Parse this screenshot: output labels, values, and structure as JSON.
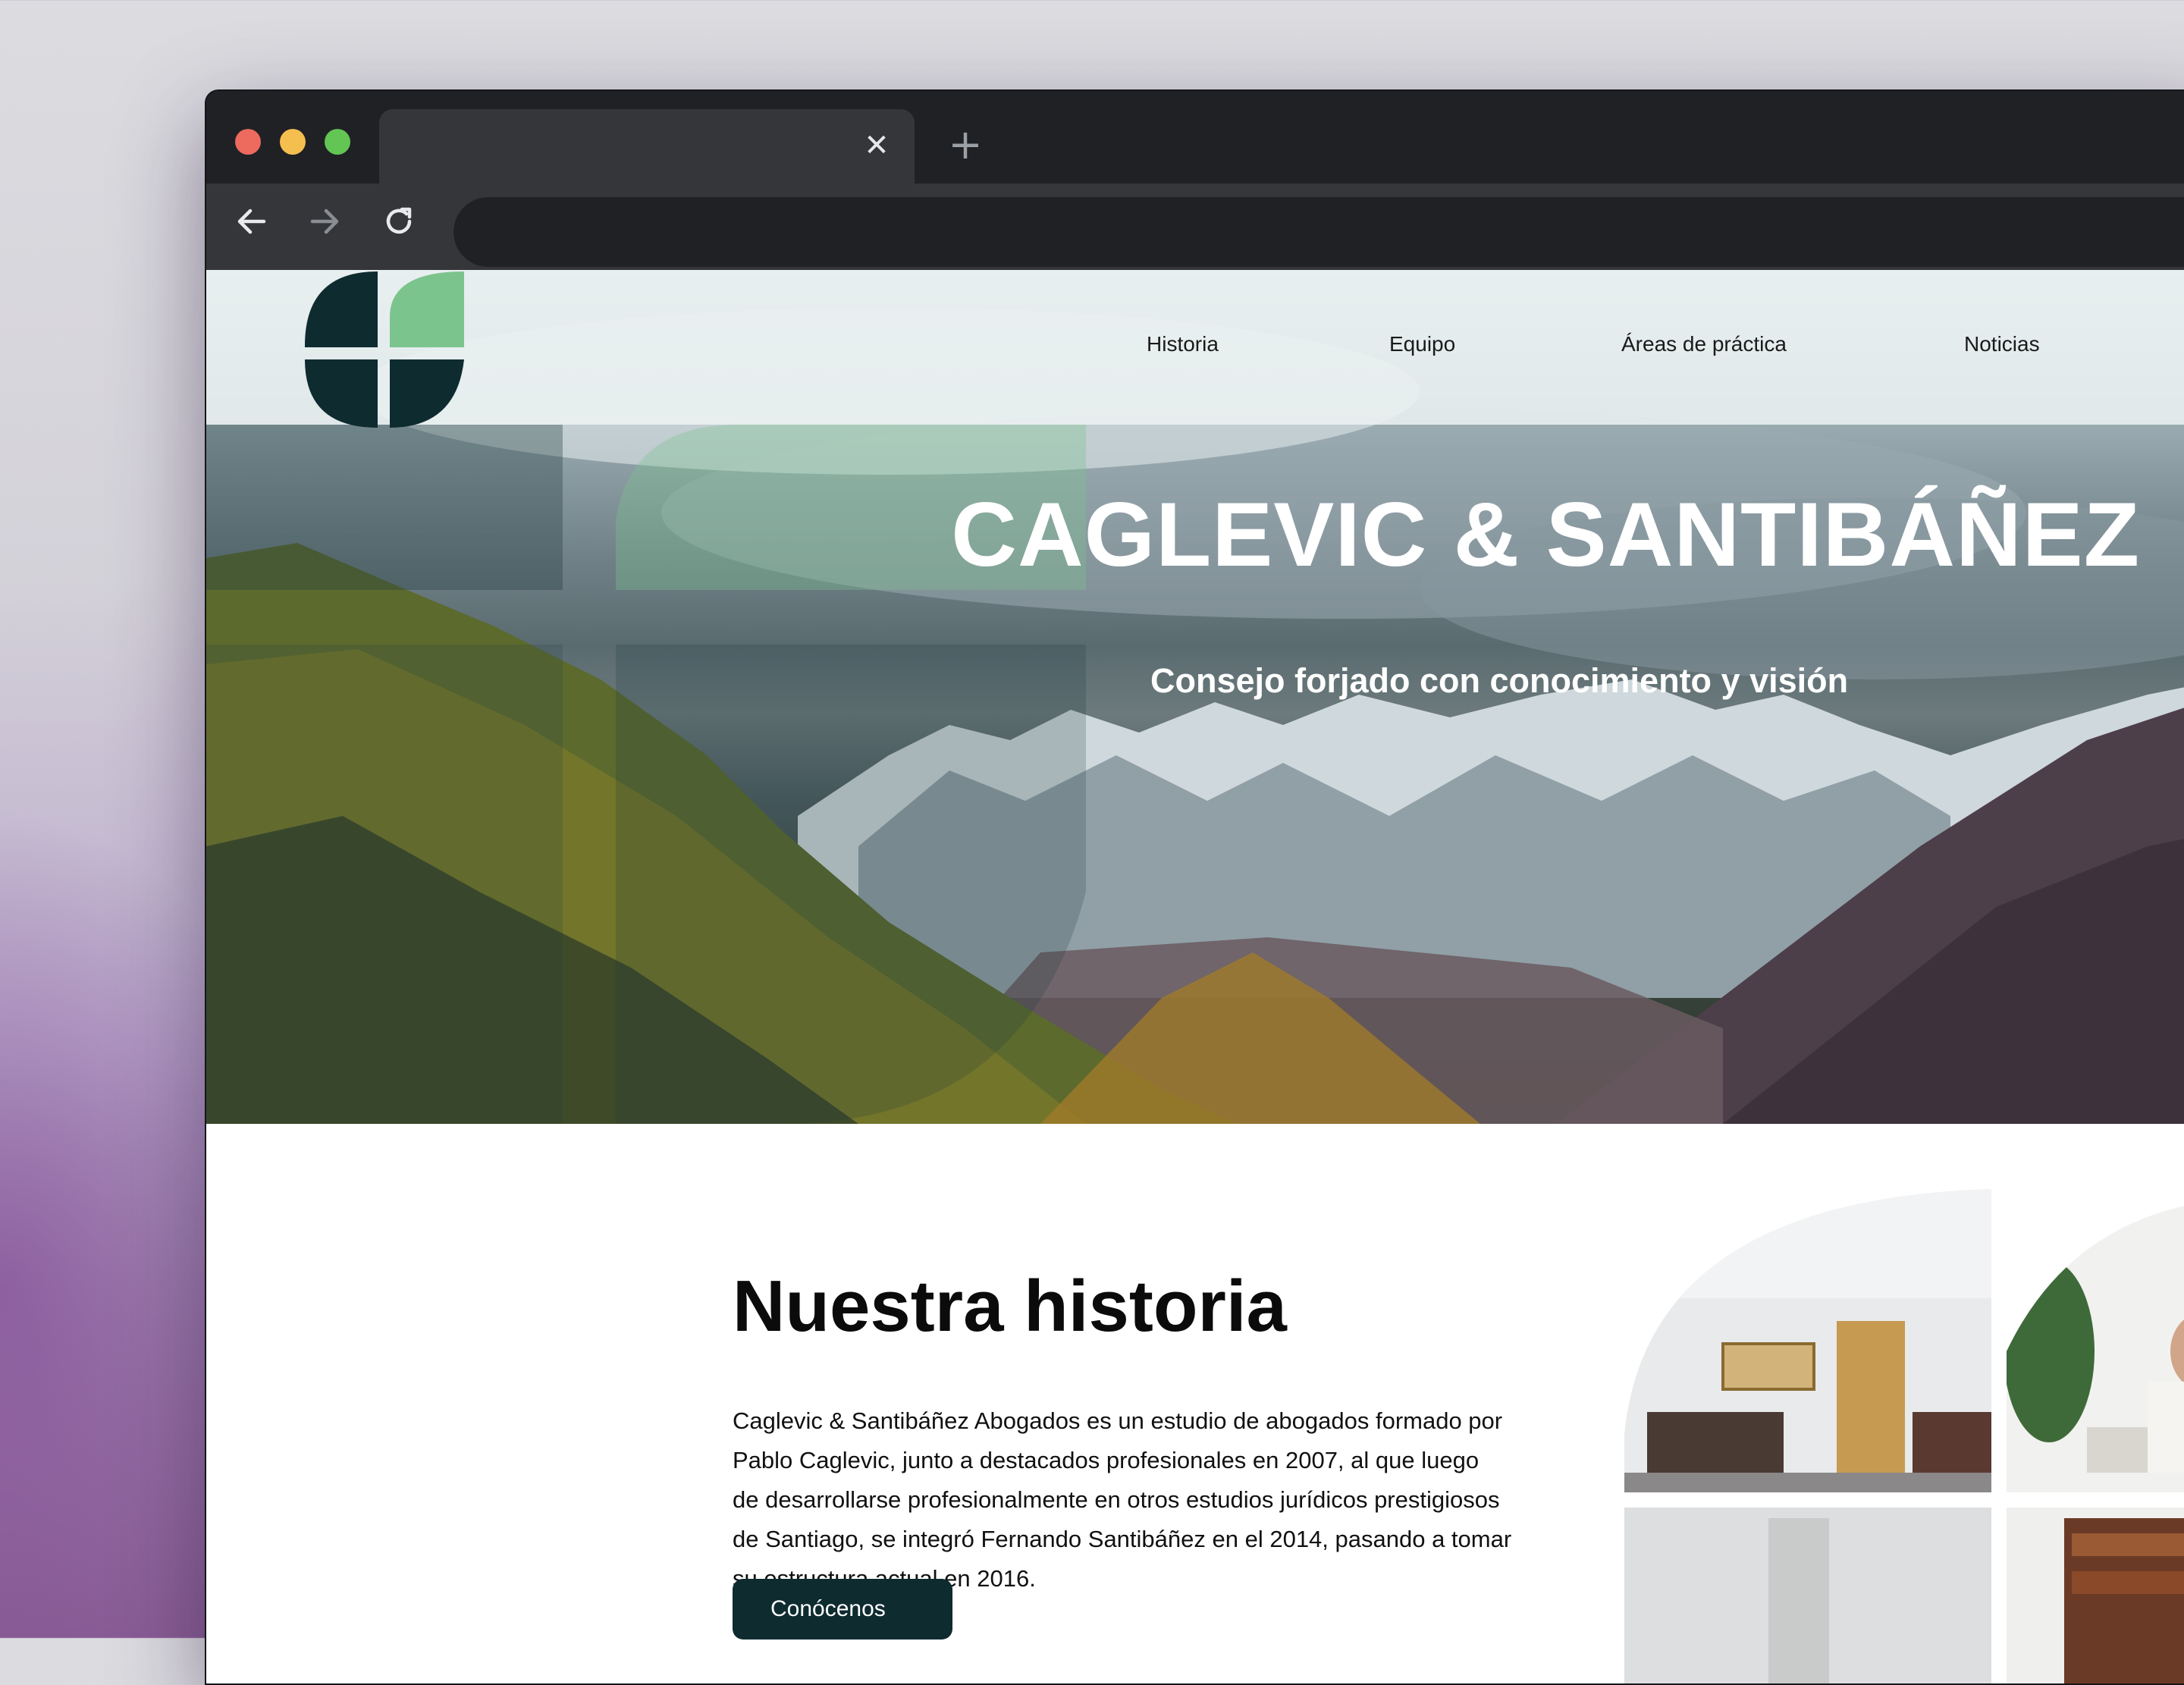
{
  "browser": {
    "tab_close_icon": "close-icon",
    "new_tab_icon": "plus-icon",
    "address_value": "",
    "buttons": [
      "back-arrow-icon",
      "forward-arrow-icon",
      "reload-icon"
    ]
  },
  "nav": {
    "items": [
      {
        "label": "Historia"
      },
      {
        "label": "Equipo"
      },
      {
        "label": "Áreas de práctica"
      },
      {
        "label": "Noticias"
      }
    ]
  },
  "hero": {
    "title": "CAGLEVIC & SANTIBÁÑEZ",
    "subtitle": "Consejo forjado con conocimiento y visión"
  },
  "history": {
    "title": "Nuestra historia",
    "lines": [
      "Caglevic & Santibáñez Abogados es un estudio de abogados formado por",
      "Pablo Caglevic, junto a destacados profesionales en 2007, al que luego",
      "de desarrollarse profesionalmente en otros estudios jurídicos prestigiosos",
      "de Santiago, se integró Fernando Santibáñez en el 2014, pasando a tomar",
      "su estructura actual en 2016."
    ],
    "button_label": "Conócenos"
  },
  "colors": {
    "logo_dark": "#0e2b30",
    "logo_green": "#7cc48e",
    "button_bg": "#0e2b30"
  }
}
